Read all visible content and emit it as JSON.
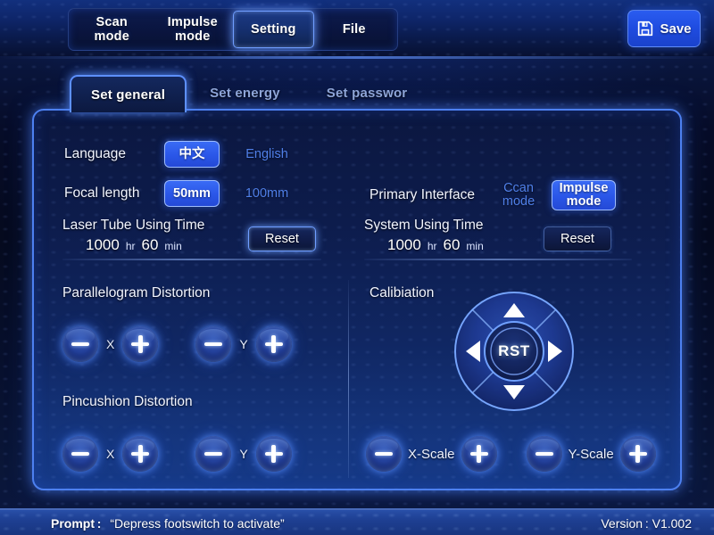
{
  "header": {
    "nav": [
      {
        "line1": "Scan",
        "line2": "mode",
        "active": false
      },
      {
        "line1": "Impulse",
        "line2": "mode",
        "active": false
      },
      {
        "line1": "Setting",
        "line2": "",
        "active": true
      },
      {
        "line1": "File",
        "line2": "",
        "active": false
      }
    ],
    "save_label": "Save",
    "save_icon": "floppy-disk-icon"
  },
  "tabs": [
    {
      "label": "Set general",
      "active": true
    },
    {
      "label": "Set energy",
      "active": false
    },
    {
      "label": "Set passwor",
      "active": false
    }
  ],
  "settings": {
    "language": {
      "label": "Language",
      "options": [
        {
          "value": "中文",
          "selected": true
        },
        {
          "value": "English",
          "selected": false
        }
      ]
    },
    "focal_length": {
      "label": "Focal length",
      "options": [
        {
          "value": "50mm",
          "selected": true
        },
        {
          "value": "100mm",
          "selected": false
        }
      ]
    },
    "primary_interface": {
      "label": "Primary Interface",
      "options": [
        {
          "line1": "Ccan",
          "line2": "mode",
          "selected": false
        },
        {
          "line1": "Impulse",
          "line2": "mode",
          "selected": true
        }
      ]
    },
    "laser_tube_time": {
      "label": "Laser Tube Using Time",
      "hours": "1000",
      "hours_unit": "hr",
      "minutes": "60",
      "minutes_unit": "min",
      "reset_label": "Reset"
    },
    "system_time": {
      "label": "System Using Time",
      "hours": "1000",
      "hours_unit": "hr",
      "minutes": "60",
      "minutes_unit": "min",
      "reset_label": "Reset"
    },
    "parallelogram": {
      "title": "Parallelogram Distortion",
      "x_label": "X",
      "y_label": "Y",
      "minus_icon": "minus-icon",
      "plus_icon": "plus-icon"
    },
    "pincushion": {
      "title": "Pincushion Distortion",
      "x_label": "X",
      "y_label": "Y",
      "minus_icon": "minus-icon",
      "plus_icon": "plus-icon"
    },
    "calibration": {
      "title": "Calibiation",
      "center_label": "RST",
      "up_icon": "triangle-up-icon",
      "down_icon": "triangle-down-icon",
      "left_icon": "triangle-left-icon",
      "right_icon": "triangle-right-icon"
    },
    "x_scale": {
      "label": "X-Scale",
      "minus_icon": "minus-icon",
      "plus_icon": "plus-icon"
    },
    "y_scale": {
      "label": "Y-Scale",
      "minus_icon": "minus-icon",
      "plus_icon": "plus-icon"
    }
  },
  "statusbar": {
    "prompt_label": "Prompt :",
    "prompt_text": "“Depress footswitch to activate”",
    "version": "Version :  V1.002"
  },
  "colors": {
    "accent": "#2a56e8",
    "glow_border": "#5d90ff",
    "panel_bg": "#102763",
    "text": "#ffffff",
    "muted_text": "#4f7fe8",
    "statusbar_bg": "#1e3f92"
  }
}
